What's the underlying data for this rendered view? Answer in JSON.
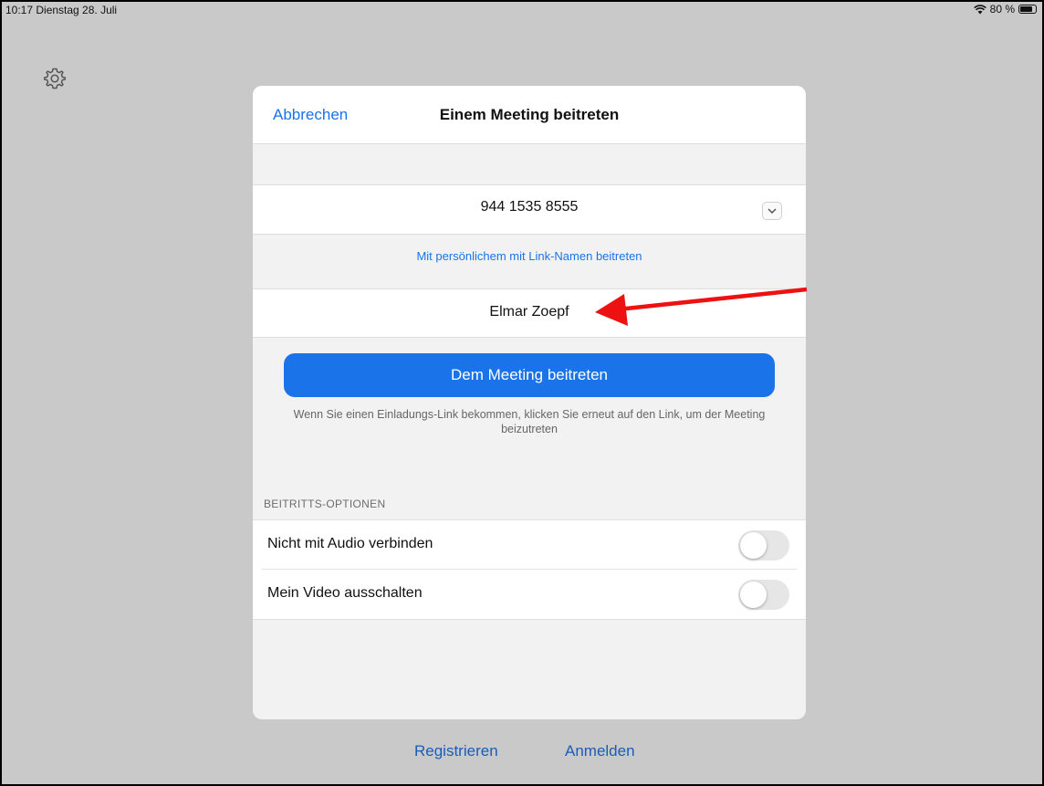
{
  "status_bar": {
    "time_date": "10:17  Dienstag 28. Juli",
    "battery": "80 %"
  },
  "modal": {
    "cancel_label": "Abbrechen",
    "title": "Einem Meeting beitreten",
    "meeting_id": "944 1535 8555",
    "link_name_label": "Mit persönlichem mit Link-Namen beitreten",
    "display_name": "Elmar Zoepf",
    "join_button": "Dem Meeting beitreten",
    "hint": "Wenn Sie einen Einladungs-Link bekommen, klicken Sie erneut auf den Link, um der Meeting beizutreten",
    "options_header": "BEITRITTS-OPTIONEN",
    "options": [
      {
        "label": "Nicht mit Audio verbinden",
        "enabled": false
      },
      {
        "label": "Mein Video ausschalten",
        "enabled": false
      }
    ]
  },
  "footer": {
    "register_label": "Registrieren",
    "login_label": "Anmelden"
  },
  "annotation": {
    "arrow_color": "#ee1111"
  },
  "colors": {
    "accent": "#1a73e8",
    "background": "#c9c9c9"
  },
  "icons": [
    "gear-icon",
    "wifi-icon",
    "battery-icon",
    "chevron-down-icon",
    "red-arrow-annotation"
  ]
}
